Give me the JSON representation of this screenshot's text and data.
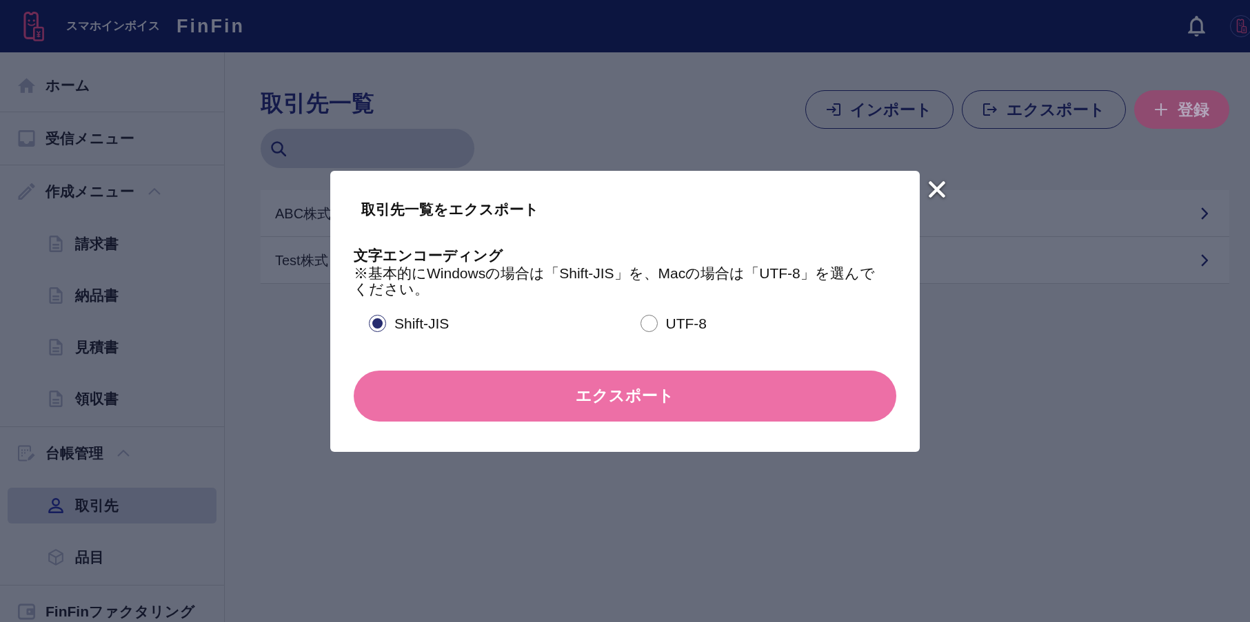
{
  "header": {
    "app_name": "スマホインボイス",
    "brand": "FinFin"
  },
  "sidebar": {
    "items": [
      {
        "label": "ホーム",
        "selected": false
      },
      {
        "label": "受信メニュー",
        "selected": false
      },
      {
        "label": "作成メニュー",
        "selected": false,
        "expanded": true,
        "children": [
          {
            "label": "請求書",
            "selected": false
          },
          {
            "label": "納品書",
            "selected": false
          },
          {
            "label": "見積書",
            "selected": false
          },
          {
            "label": "領収書",
            "selected": false
          }
        ]
      },
      {
        "label": "台帳管理",
        "selected": false,
        "expanded": true,
        "children": [
          {
            "label": "取引先",
            "selected": true
          },
          {
            "label": "品目",
            "selected": false
          }
        ]
      },
      {
        "label": "FinFinファクタリング",
        "selected": false
      }
    ]
  },
  "page": {
    "title": "取引先一覧",
    "toolbar": [
      {
        "kind": "import",
        "label": "インポート"
      },
      {
        "kind": "export",
        "label": "エクスポート"
      },
      {
        "kind": "add",
        "label": "登録"
      }
    ],
    "rows": [
      {
        "name": "ABC株式"
      },
      {
        "name": "Test株式"
      }
    ]
  },
  "dialog": {
    "title": "取引先一覧をエクスポート",
    "field_label": "文字エンコーディング",
    "note": "※基本的にWindowsの場合は「Shift-JIS」を、Macの場合は「UTF-8」を選んでください。",
    "options": [
      {
        "label": "Shift-JIS",
        "selected": true
      },
      {
        "label": "UTF-8",
        "selected": false
      }
    ],
    "submit": "エクスポート"
  }
}
